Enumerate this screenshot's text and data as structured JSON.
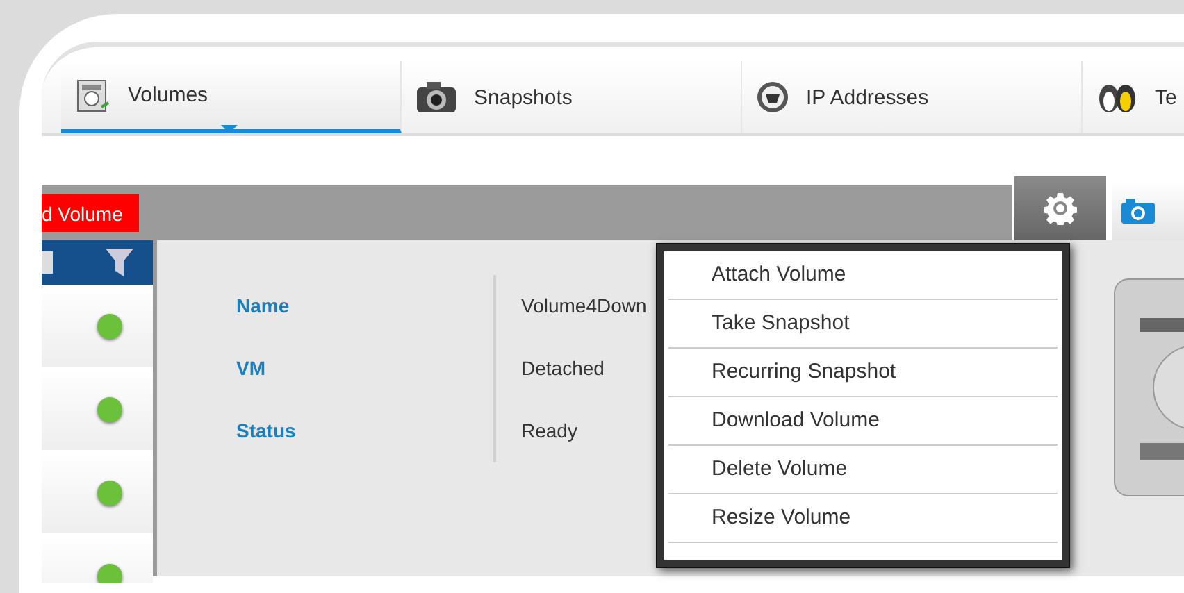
{
  "tabs": [
    {
      "label": "Volumes",
      "selected": true
    },
    {
      "label": "Snapshots",
      "selected": false
    },
    {
      "label": "IP Addresses",
      "selected": false
    },
    {
      "label": "Te",
      "selected": false
    }
  ],
  "toolbar": {
    "add_button": "d Volume"
  },
  "list": {
    "rows": [
      {
        "color": "#6cc13a"
      },
      {
        "color": "#6cc13a"
      },
      {
        "color": "#6cc13a"
      },
      {
        "color": "#6cc13a"
      }
    ]
  },
  "details": [
    {
      "label": "Name",
      "value": "Volume4Down"
    },
    {
      "label": "VM",
      "value": "Detached"
    },
    {
      "label": "Status",
      "value": "Ready"
    }
  ],
  "actions_menu": [
    "Attach Volume",
    "Take Snapshot",
    "Recurring Snapshot",
    "Download Volume",
    "Delete Volume",
    "Resize Volume"
  ]
}
